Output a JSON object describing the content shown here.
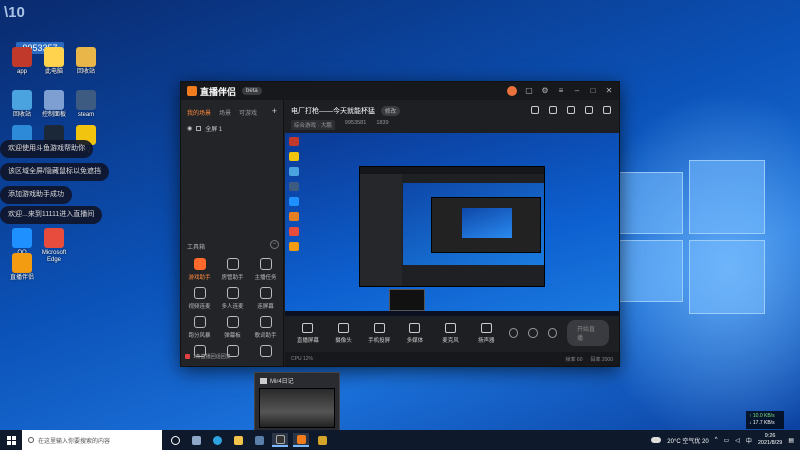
{
  "overlay": {
    "corner_text": "\\10",
    "id_number": "9953357"
  },
  "desktop_icons": [
    {
      "label": "app",
      "color": "#c0392b"
    },
    {
      "label": "此电脑",
      "color": "#ffd34d"
    },
    {
      "label": "回收站",
      "color": "#e9b64a"
    },
    {
      "label": "回收站",
      "color": "#4aa3df"
    },
    {
      "label": "控制面板",
      "color": "#7d9fd1"
    },
    {
      "label": "steam",
      "color": "#3d5a80"
    },
    {
      "label": "OneDrive",
      "color": "#2d8ad8"
    },
    {
      "label": "Steam",
      "color": "#1b2838"
    },
    {
      "label": "QQ",
      "color": "#f1c40f"
    },
    {
      "label": "QQ",
      "color": "#1e90ff"
    },
    {
      "label": "Microsoft Edge",
      "color": "#e74c3c"
    },
    {
      "label": "直播伴侣",
      "color": "#f39c12"
    }
  ],
  "notifications": [
    "欢迎使用斗鱼游戏帮助你",
    "该区域全屏/隐藏鼠标以免遮挡",
    "添加游戏助手成功",
    "欢迎...来到11111进入直播间"
  ],
  "app": {
    "name": "直播伴侣",
    "version": "beta",
    "left_tabs": [
      "我的场景",
      "场景",
      "可游戏"
    ],
    "scene_label": "全屏 1",
    "tools_title": "工具箱",
    "tools": [
      {
        "label": "游戏助手",
        "hot": true
      },
      {
        "label": "房管助手",
        "hot": false
      },
      {
        "label": "主播任务",
        "hot": false
      },
      {
        "label": "视频连麦",
        "hot": false
      },
      {
        "label": "多人连麦",
        "hot": false
      },
      {
        "label": "连屏幕",
        "hot": false
      },
      {
        "label": "跑分风暴",
        "hot": false
      },
      {
        "label": "弹幕板",
        "hot": false
      },
      {
        "label": "歌词助手",
        "hot": false
      },
      {
        "label": "",
        "hot": false
      },
      {
        "label": "",
        "hot": false
      },
      {
        "label": "",
        "hot": false
      }
    ],
    "left_status": "1条直播回话回复",
    "room_title": "电厂打枪——今天就能杯猛",
    "room_tag": "修改",
    "room_category": "综合游戏 · 大鹏",
    "room_id": "9953581",
    "room_hot": "1839",
    "controls": [
      {
        "label": "直播屏幕"
      },
      {
        "label": "摄像头"
      },
      {
        "label": "手机投屏"
      },
      {
        "label": "多媒体"
      },
      {
        "label": "麦克风"
      },
      {
        "label": "扬声器"
      }
    ],
    "go_live": "开始直播",
    "status_left": "CPU 12%",
    "status_right": [
      "帧率 60",
      "码率 2000"
    ]
  },
  "popup": {
    "title": "Mir4日记"
  },
  "taskbar": {
    "search_placeholder": "在这里输入你要搜索的内容",
    "weather": "20°C 空气优 20",
    "ime": "中",
    "time": "9:26",
    "date": "2021/8/29"
  },
  "netspeed": {
    "up": "↑ 10.0 KB/s",
    "down": "↓ 17.7 KB/s"
  }
}
